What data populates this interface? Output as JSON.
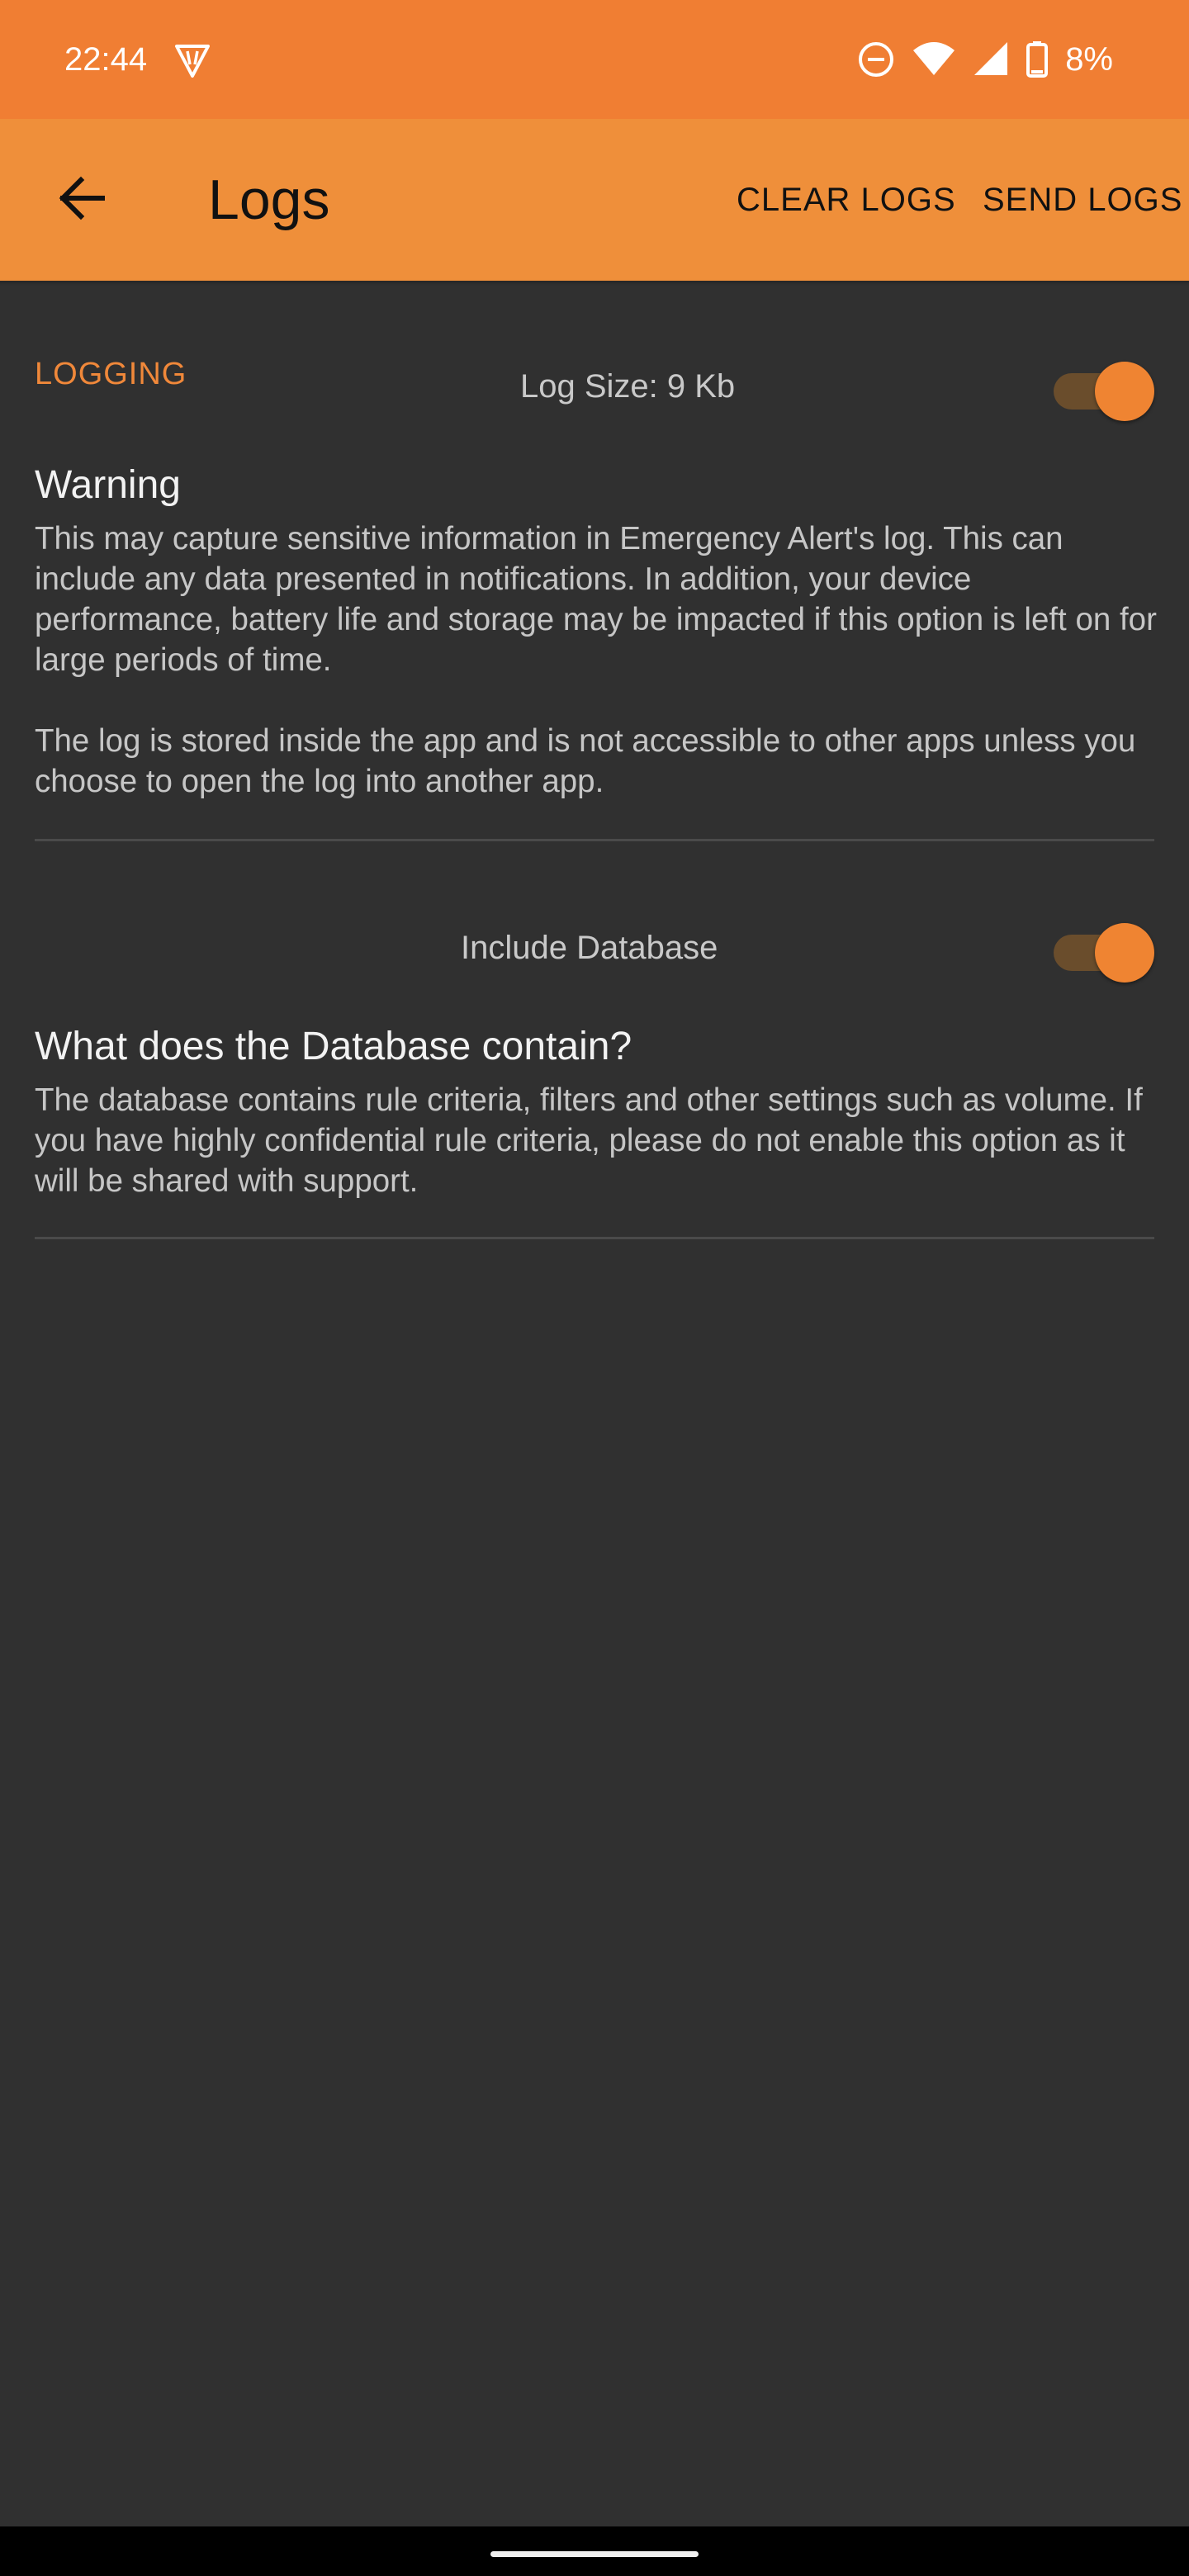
{
  "status_bar": {
    "time": "22:44",
    "left_icon": "vpn-shield-icon",
    "right_icons": [
      "do-not-disturb-icon",
      "wifi-icon",
      "cell-signal-icon",
      "battery-icon"
    ],
    "battery_percent": "8%"
  },
  "app_bar": {
    "title": "Logs",
    "back_icon": "arrow-back-icon",
    "clear_logs_label": "CLEAR LOGS",
    "send_logs_label": "SEND LOGS",
    "color": "#ef8f3a"
  },
  "logging_section": {
    "header": "LOGGING",
    "log_size_label": "Log Size: 9 Kb",
    "logging_enabled": true,
    "warning_title": "Warning",
    "warning_body": "This may capture sensitive information in Emergency Alert's log. This can include any data presented in notifications. In addition, your device performance, battery life and storage may be impacted if this option is left on for large periods of time.\n\nThe log is stored inside the app and is not accessible to other apps unless you choose to open the log into another app."
  },
  "database_section": {
    "include_database_label": "Include Database",
    "include_database_enabled": true,
    "title": "What does the Database contain?",
    "body": "The database contains rule criteria, filters and other settings such as volume. If you have highly confidential rule criteria, please do not enable this option as it will be shared with support."
  },
  "colors": {
    "accent": "#f0883a",
    "status_bar": "#f07e33",
    "background": "#303030"
  }
}
